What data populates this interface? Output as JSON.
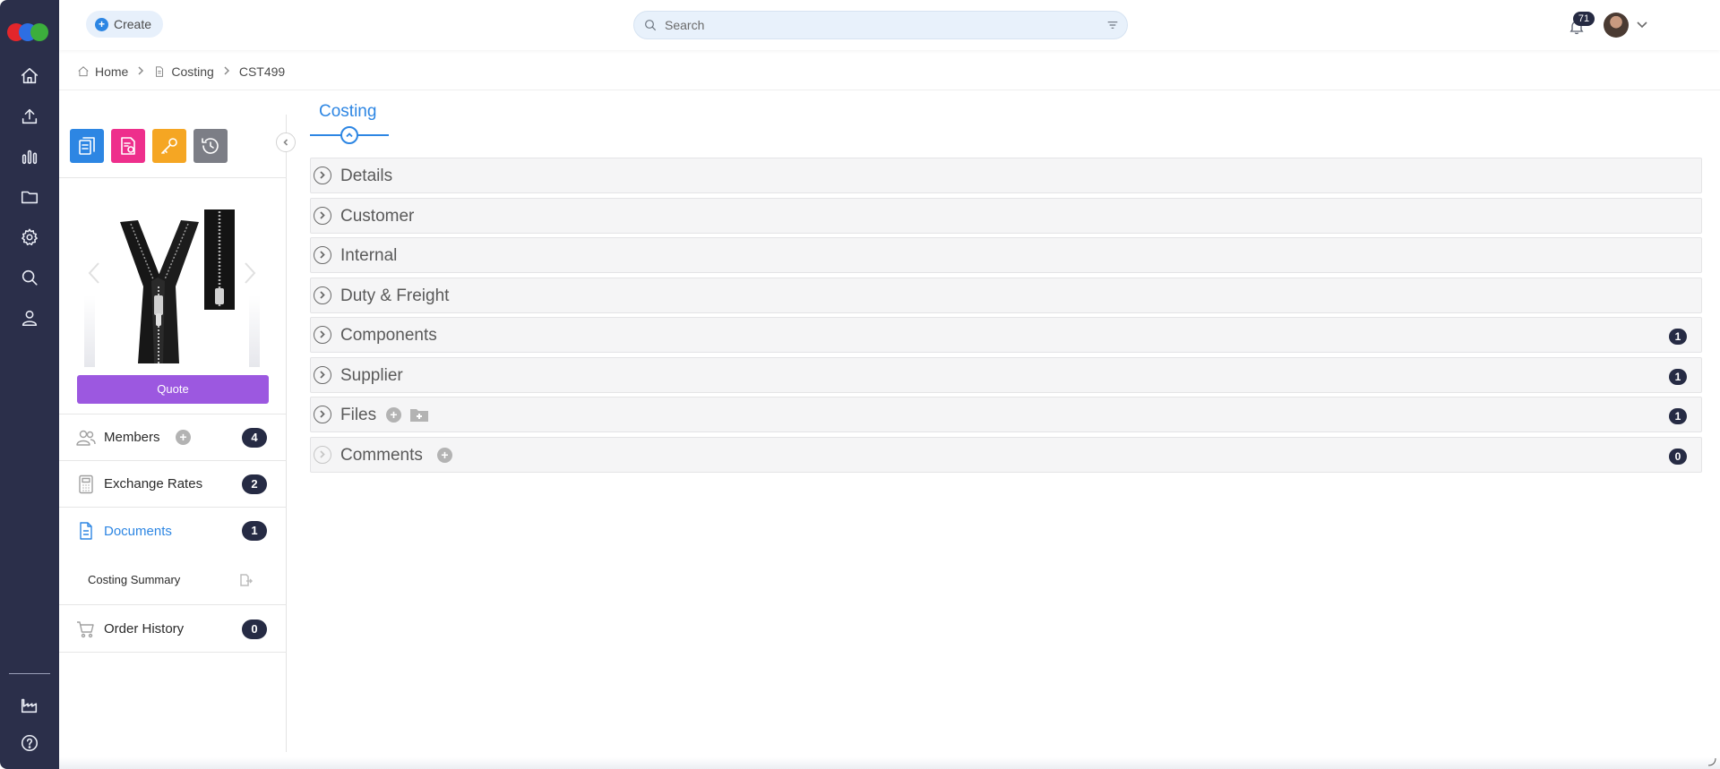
{
  "topbar": {
    "create_label": "Create",
    "search_placeholder": "Search",
    "notification_count": "71"
  },
  "breadcrumb": {
    "items": [
      "Home",
      "Costing",
      "CST499"
    ]
  },
  "left_panel": {
    "tools": [
      {
        "icon": "cost-sheet-icon",
        "color": "#2d86e3"
      },
      {
        "icon": "report-icon",
        "color": "#ee2f8c"
      },
      {
        "icon": "key-icon",
        "color": "#f5a623"
      },
      {
        "icon": "history-icon",
        "color": "#7c7e86"
      }
    ],
    "quote_label": "Quote",
    "rows": [
      {
        "label": "Members",
        "count": "4"
      },
      {
        "label": "Exchange Rates",
        "count": "2"
      },
      {
        "label": "Documents",
        "count": "1"
      },
      {
        "label": "Order History",
        "count": "0"
      }
    ],
    "documents_sub": "Costing Summary"
  },
  "main": {
    "tab_label": "Costing",
    "sections": [
      {
        "title": "Details",
        "count": ""
      },
      {
        "title": "Customer",
        "count": ""
      },
      {
        "title": "Internal",
        "count": ""
      },
      {
        "title": "Duty & Freight",
        "count": ""
      },
      {
        "title": "Components",
        "count": "1"
      },
      {
        "title": "Supplier",
        "count": "1"
      },
      {
        "title": "Files",
        "count": "1"
      },
      {
        "title": "Comments",
        "count": "0"
      }
    ]
  },
  "colors": {
    "rail": "#2b2f4a",
    "accent": "#2d86e3",
    "quote": "#9c58e0",
    "badge": "#262b44"
  }
}
